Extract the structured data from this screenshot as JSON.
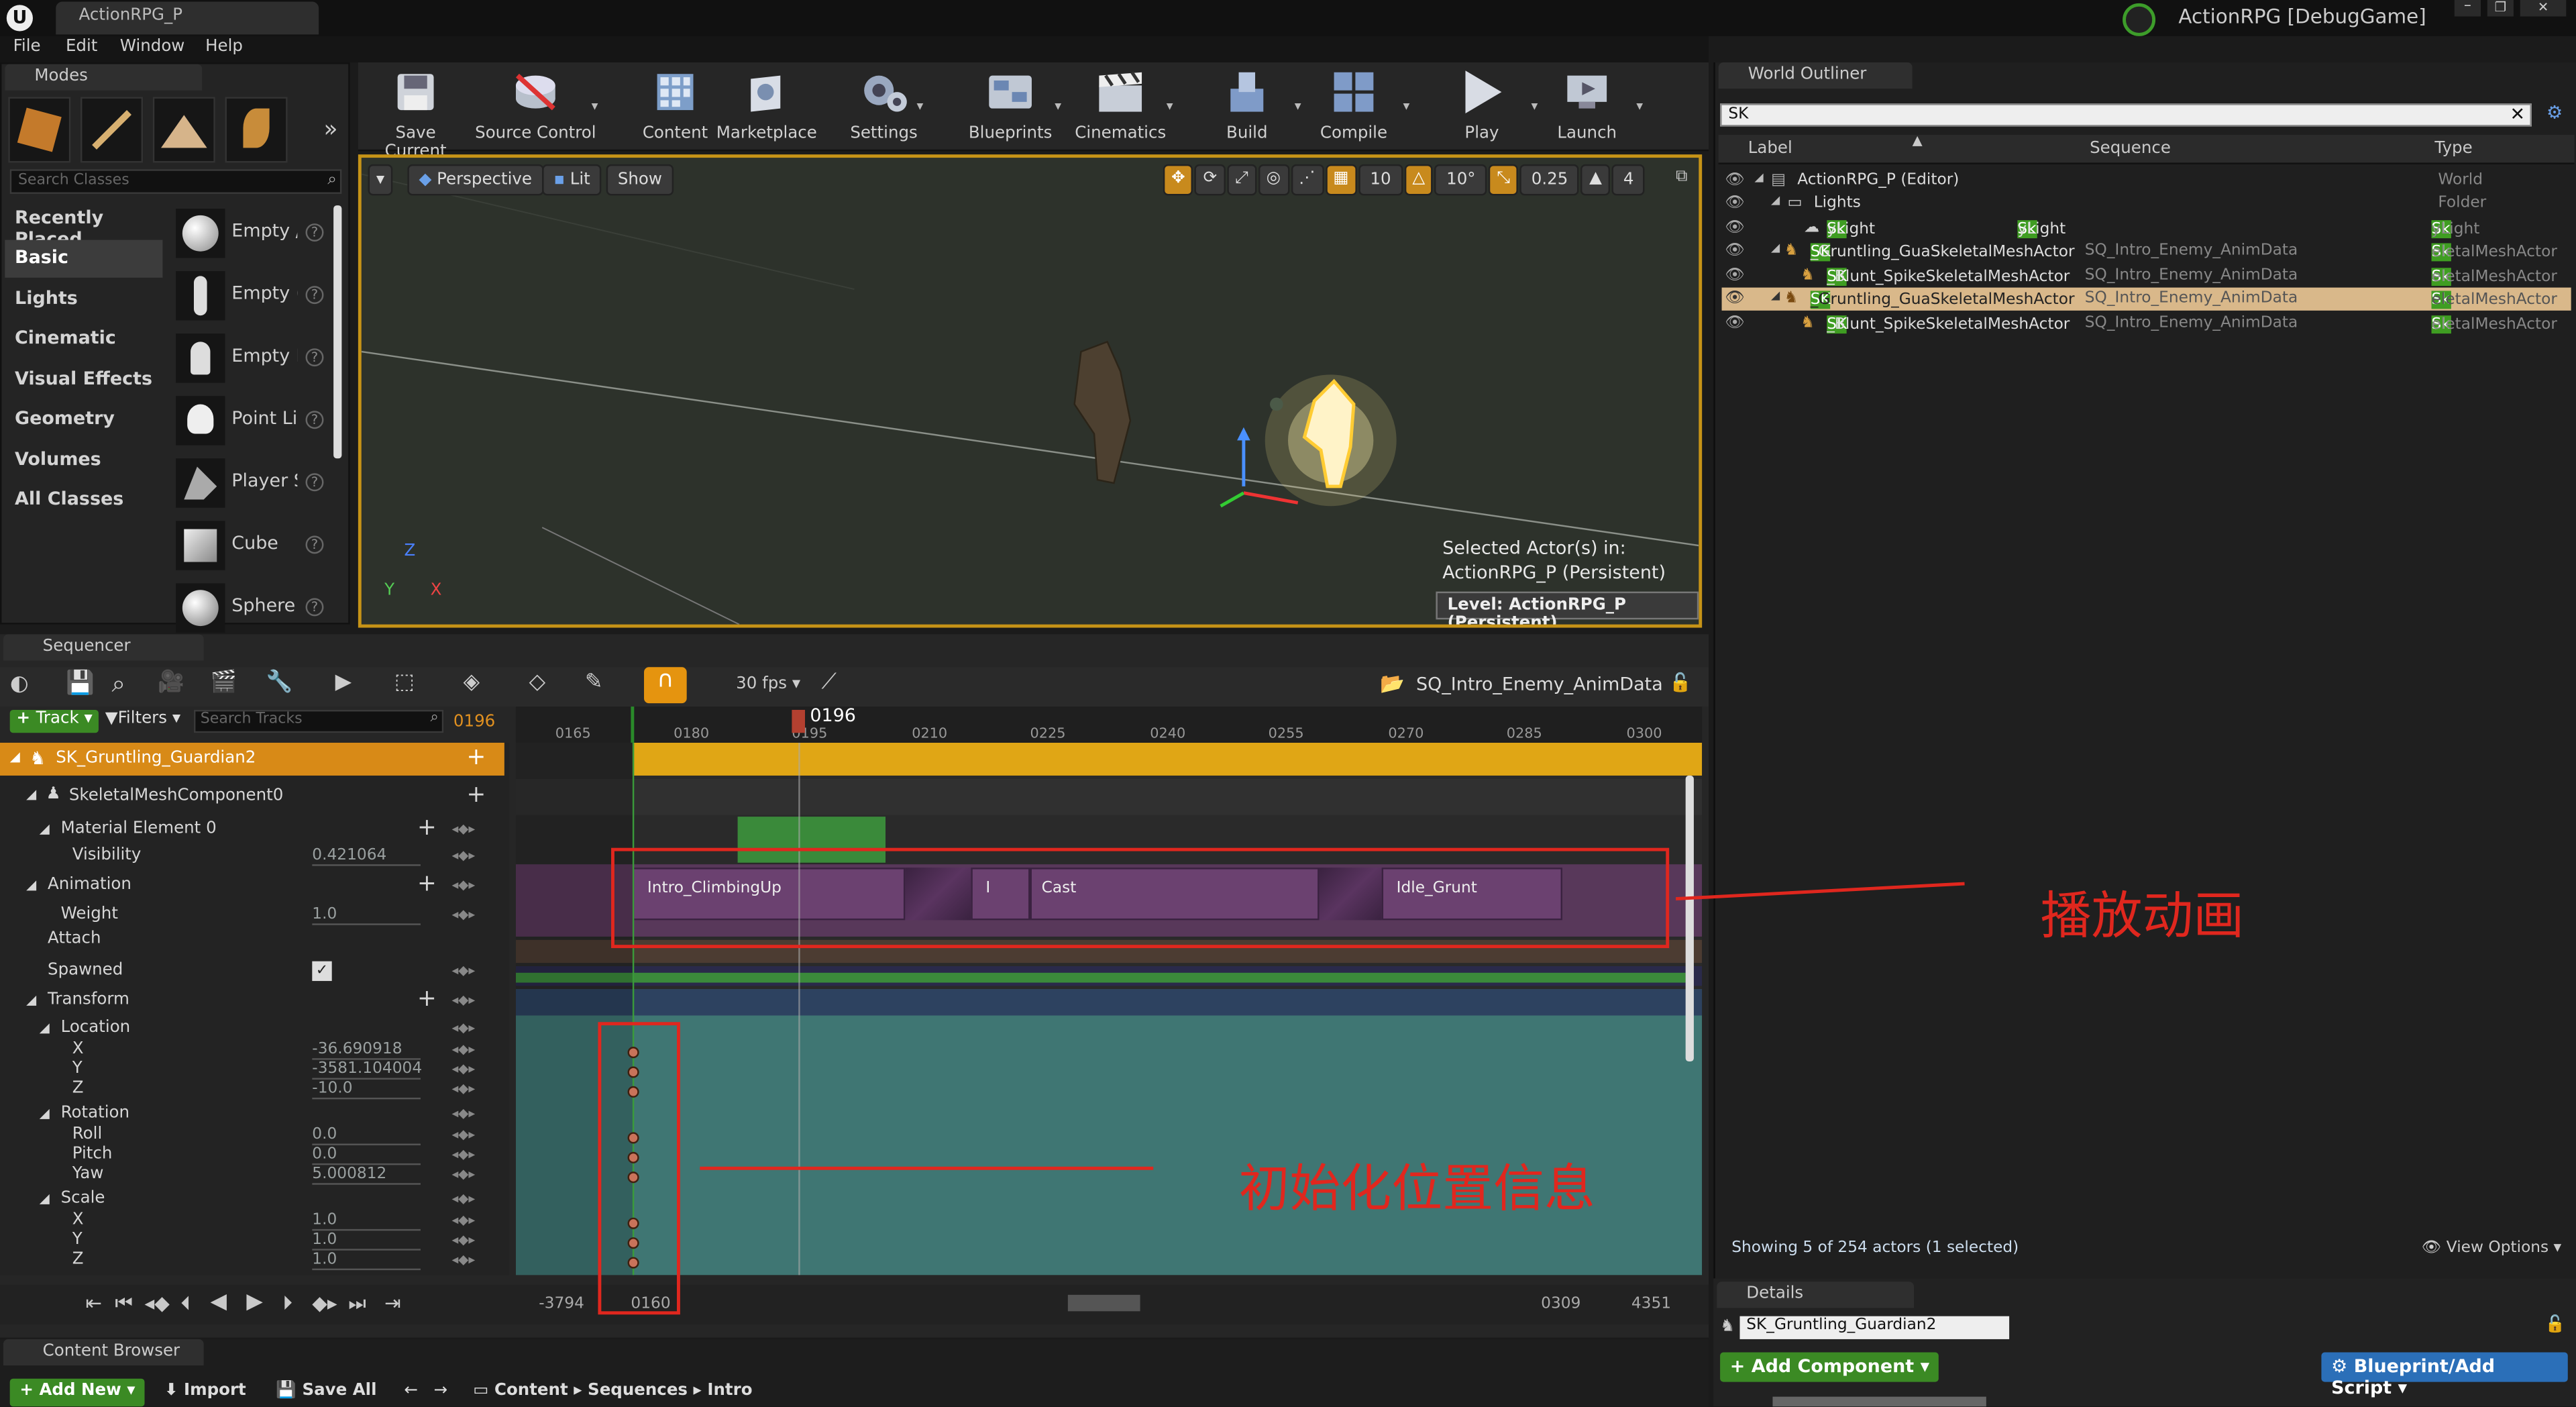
{
  "window": {
    "doc_tab": "ActionRPG_P",
    "app_title": "ActionRPG [DebugGame]"
  },
  "menu": [
    "File",
    "Edit",
    "Window",
    "Help"
  ],
  "modes": {
    "tab": "Modes",
    "search_placeholder": "Search Classes",
    "categories": [
      "Recently Placed",
      "Basic",
      "Lights",
      "Cinematic",
      "Visual Effects",
      "Geometry",
      "Volumes",
      "All Classes"
    ],
    "selected_category": "Basic",
    "place_items": [
      "Empty /",
      "Empty (",
      "Empty I",
      "Point Li",
      "Player S",
      "Cube",
      "Sphere"
    ]
  },
  "toolbar": {
    "items": [
      "Save Current",
      "Source Control",
      "Content",
      "Marketplace",
      "Settings",
      "Blueprints",
      "Cinematics",
      "Build",
      "Compile",
      "Play",
      "Launch"
    ]
  },
  "viewport": {
    "perspective": "Perspective",
    "lit": "Lit",
    "show": "Show",
    "grid_snap": "10",
    "rot_snap": "10°",
    "scale_snap": "0.25",
    "cam_speed": "4",
    "selected_line1": "Selected Actor(s) in:",
    "selected_line2": "ActionRPG_P (Persistent)",
    "level_badge": "Level:  ActionRPG_P (Persistent)",
    "axis_y": "Y",
    "axis_x": "X",
    "axis_z": "Z"
  },
  "outliner": {
    "tab": "World Outliner",
    "search_value": "SK",
    "columns": [
      "Label",
      "Sequence",
      "Type"
    ],
    "rows": [
      {
        "pre": "ActionRPG_P (Editor)",
        "hl": "",
        "post": "",
        "seq": "",
        "type_hl": "",
        "type": "World"
      },
      {
        "pre": "Lights",
        "hl": "",
        "post": "",
        "seq": "",
        "type_hl": "",
        "type": "Folder"
      },
      {
        "pre": "",
        "hl": "Sk",
        "post": "yLight",
        "seq": "SkyLight",
        "type_hl": "Sk",
        "type": "yLight"
      },
      {
        "pre": "",
        "hl": "SK",
        "post": "_Gruntling_GuaSkeletalMeshActor",
        "seq": "SQ_Intro_Enemy_AnimData",
        "type_hl": "Sk",
        "type": "eletalMeshActor"
      },
      {
        "pre": "",
        "hl": "SK",
        "post": "_Blunt_SpikeSkeletalMeshActor",
        "seq": "SQ_Intro_Enemy_AnimData",
        "type_hl": "Sk",
        "type": "eletalMeshActor"
      },
      {
        "pre": "",
        "hl": "SK",
        "post": "_Gruntling_GuaSkeletalMeshActor",
        "seq": "SQ_Intro_Enemy_AnimData",
        "type_hl": "Sk",
        "type": "eletalMeshActor"
      },
      {
        "pre": "",
        "hl": "SK",
        "post": "_Blunt_SpikeSkeletalMeshActor",
        "seq": "SQ_Intro_Enemy_AnimData",
        "type_hl": "Sk",
        "type": "eletalMeshActor"
      }
    ],
    "footer": "Showing 5 of 254 actors (1 selected)",
    "view_options": "View Options"
  },
  "sequencer": {
    "tab": "Sequencer",
    "fps": "30 fps",
    "sequence_name": "SQ_Intro_Enemy_AnimData",
    "add_track": "Track",
    "filters": "Filters",
    "search_placeholder": "Search Tracks",
    "current_frame": "0196",
    "playhead": "0196",
    "ruler": [
      "0165",
      "0180",
      "0195",
      "0210",
      "0225",
      "0240",
      "0255",
      "0270",
      "0285",
      "0300"
    ],
    "actor": "SK_Gruntling_Guardian2",
    "component": "SkeletalMeshComponent0",
    "material": "Material Element 0",
    "visibility_label": "Visibility",
    "visibility_value": "0.421064",
    "animation": "Animation",
    "weight_label": "Weight",
    "weight_value": "1.0",
    "attach": "Attach",
    "spawned": "Spawned",
    "transform": "Transform",
    "location": "Location",
    "loc": [
      {
        "k": "X",
        "v": "-36.690918"
      },
      {
        "k": "Y",
        "v": "-3581.104004"
      },
      {
        "k": "Z",
        "v": "-10.0"
      }
    ],
    "rotation": "Rotation",
    "rot": [
      {
        "k": "Roll",
        "v": "0.0"
      },
      {
        "k": "Pitch",
        "v": "0.0"
      },
      {
        "k": "Yaw",
        "v": "5.000812"
      }
    ],
    "scale": "Scale",
    "scl": [
      {
        "k": "X",
        "v": "1.0"
      },
      {
        "k": "Y",
        "v": "1.0"
      },
      {
        "k": "Z",
        "v": "1.0"
      }
    ],
    "anim_sections": [
      "Intro_ClimbingUp",
      "I",
      "Cast",
      "Idle_Grunt"
    ],
    "range_start_outer": "-3794",
    "range_start": "0160",
    "range_end": "0309",
    "range_end_outer": "4351"
  },
  "annotations": {
    "play_anim": "播放动画",
    "init_pos": "初始化位置信息"
  },
  "details": {
    "tab": "Details",
    "name": "SK_Gruntling_Guardian2",
    "add_component": "Add Component",
    "blueprint": "Blueprint/Add Script"
  },
  "content_browser": {
    "tab": "Content Browser",
    "add_new": "Add New",
    "import": "Import",
    "save_all": "Save All",
    "path": [
      "Content",
      "Sequences",
      "Intro"
    ]
  }
}
